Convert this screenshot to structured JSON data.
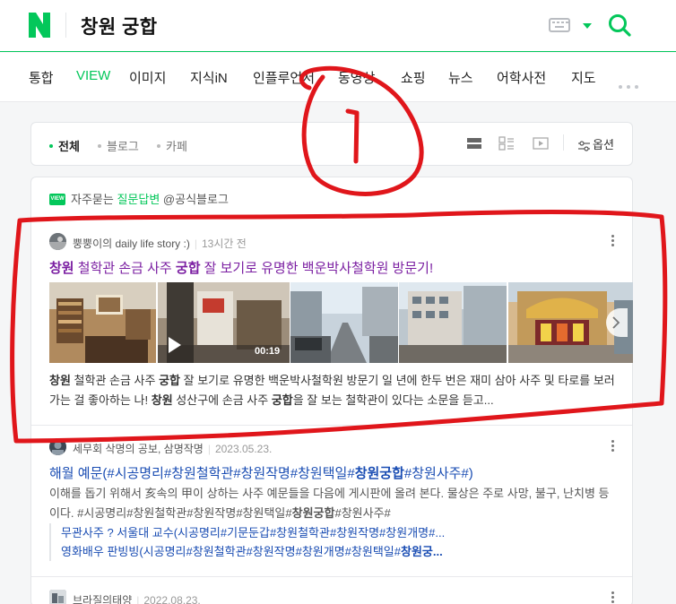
{
  "header": {
    "query": "창원 궁합",
    "logo_icon": "naver-logo-icon",
    "keyboard_icon": "keyboard-icon",
    "search_icon": "search-icon"
  },
  "tabs": [
    {
      "label": "통합",
      "active": false
    },
    {
      "label": "VIEW",
      "active": true
    },
    {
      "label": "이미지",
      "active": false
    },
    {
      "label": "지식iN",
      "active": false
    },
    {
      "label": "인플루언서",
      "active": false
    },
    {
      "label": "동영상",
      "active": false
    },
    {
      "label": "쇼핑",
      "active": false
    },
    {
      "label": "뉴스",
      "active": false
    },
    {
      "label": "어학사전",
      "active": false
    },
    {
      "label": "지도",
      "active": false
    }
  ],
  "filters": {
    "items": [
      {
        "label": "전체",
        "active": true
      },
      {
        "label": "블로그",
        "active": false
      },
      {
        "label": "카페",
        "active": false
      }
    ],
    "options_label": "옵션"
  },
  "qa": {
    "badge": "VIEW",
    "prefix": "자주묻는",
    "highlight": "질문답변",
    "suffix": " @공식블로그"
  },
  "results": [
    {
      "author": "뿡뿡이의 daily life story :)",
      "time": "13시간 전",
      "title_parts": [
        [
          "창원",
          true
        ],
        [
          " 철학관 손금 사주 ",
          false
        ],
        [
          "궁합",
          true
        ],
        [
          " 잘 보기로 유명한 백운박사철학원 방문기!",
          false
        ]
      ],
      "video_duration": "00:19",
      "desc_parts": [
        [
          "창원",
          true
        ],
        [
          " 철학관 손금 사주 ",
          false
        ],
        [
          "궁합",
          true
        ],
        [
          " 잘 보기로 유명한 백운박사철학원 방문기 일 년에 한두 번은 재미 삼아 사주 및 타로를 보러 가는 걸 좋아하는 나! ",
          false
        ],
        [
          "창원",
          true
        ],
        [
          " 성산구에 손금 사주 ",
          false
        ],
        [
          "궁합",
          true
        ],
        [
          "을 잘 보는 철학관이 있다는 소문을 듣고...",
          false
        ]
      ]
    },
    {
      "author": "세무회 삭명의 공보, 삼명작명",
      "time": "2023.05.23.",
      "title_parts": [
        [
          "해월 예문(#시공명리#창원철학관#창원작명#창원택일#",
          false
        ],
        [
          "창원궁합",
          true
        ],
        [
          "#창원사주#)",
          false
        ]
      ],
      "desc_parts": [
        [
          "이해를 돕기 위해서 亥속의 甲이 상하는 사주 예문들을 다음에 게시판에 올려 본다. 물상은 주로 사망, 불구, 난치병 등이다. #시공명리#창원철학관#창원작명#창원택일#",
          false
        ],
        [
          "창원궁합",
          true
        ],
        [
          "#창원사주#",
          false
        ]
      ],
      "sublinks": [
        [
          [
            "무관사주 ? 서울대 교수(시공명리#기문둔갑#창원철학관#창원작명#창원개명#...",
            false
          ]
        ],
        [
          [
            "영화배우 판빙빙(시공명리#창원철학관#창원작명#창원개명#창원택일#",
            false
          ],
          [
            "창원궁...",
            true
          ]
        ]
      ]
    },
    {
      "author": "브라질의태양",
      "time": "2022.08.23."
    }
  ],
  "annotation": {
    "label": "1",
    "color": "#e0161b"
  }
}
